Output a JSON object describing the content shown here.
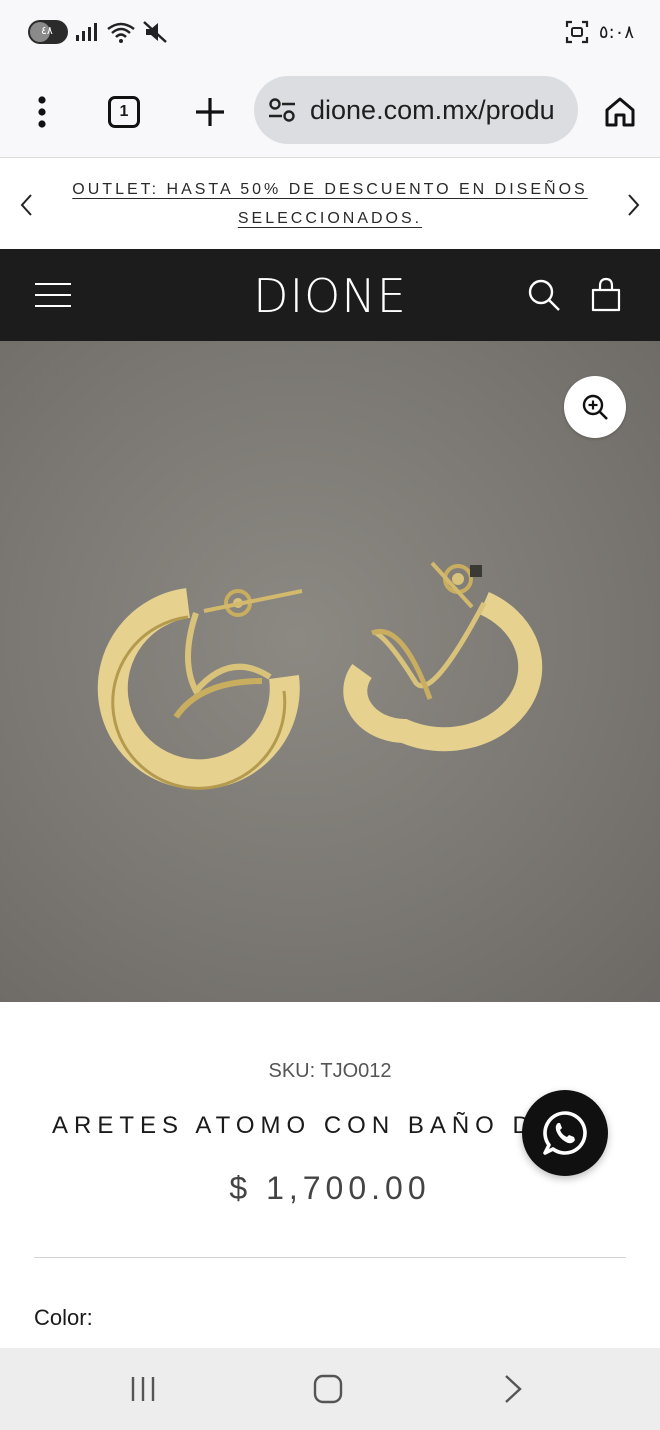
{
  "status_bar": {
    "pill_text": "٤٨",
    "time": "٥:٠٨"
  },
  "browser": {
    "url": "dione.com.mx/produ",
    "tab_count": "1",
    "icons": [
      "more-vert-icon",
      "tabs-icon",
      "plus-icon",
      "site-settings-icon",
      "home-icon"
    ]
  },
  "announcement": {
    "text": "OUTLET: HASTA 50% DE DESCUENTO EN DISEÑOS SELECCIONADOS."
  },
  "header": {
    "logo": "DIONE",
    "icons": [
      "menu-icon",
      "search-icon",
      "bag-icon"
    ]
  },
  "product": {
    "sku": "SKU: TJO012",
    "title": "ARETES ATOMO CON BAÑO DE",
    "price": "$ 1,700.00",
    "color_label": "Color:",
    "image_icons": [
      "zoom-in-icon"
    ]
  },
  "floating": {
    "icon": "whatsapp-icon"
  },
  "colors": {
    "header_bg": "#1c1c1c",
    "image_bg": "#7b7873",
    "gold": "#d8c07a"
  }
}
